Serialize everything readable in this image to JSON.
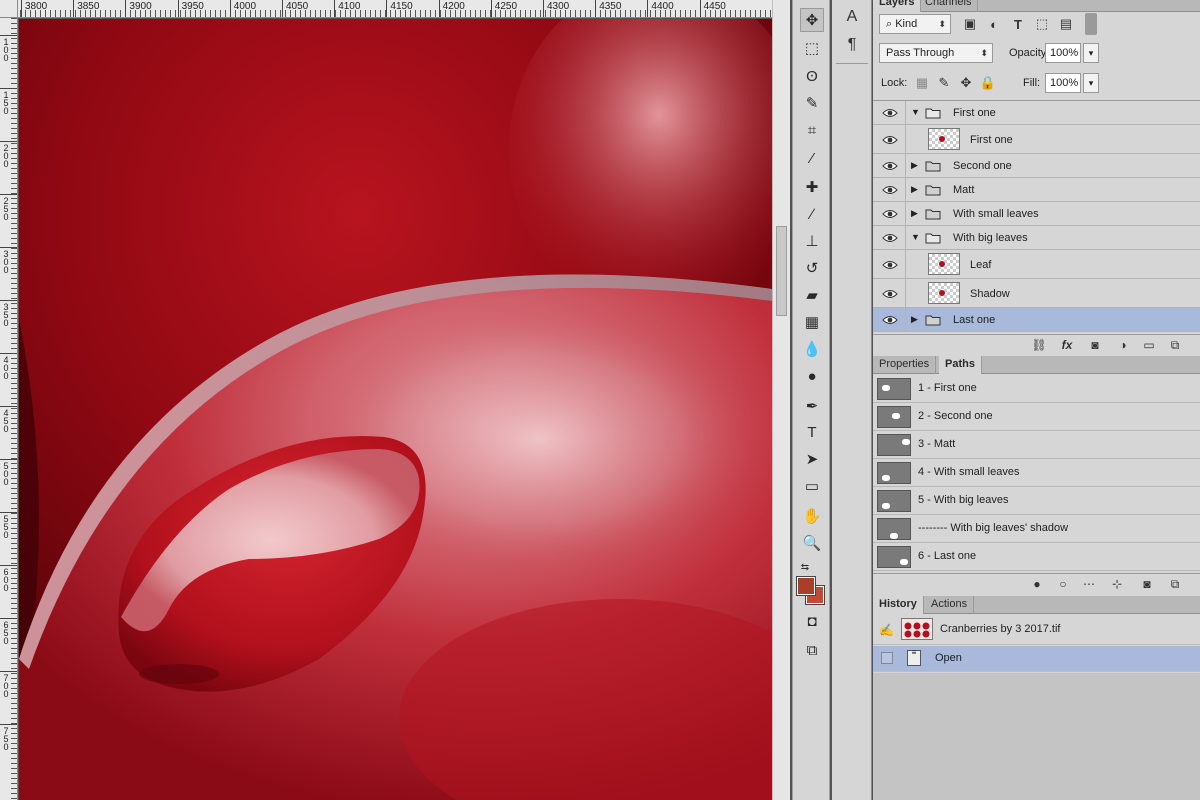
{
  "ruler": {
    "top_labels": [
      "3800",
      "3850",
      "3900",
      "3950",
      "4000",
      "4050",
      "4100",
      "4150",
      "4200",
      "4250",
      "4300",
      "4350",
      "4400",
      "4450"
    ],
    "left_labels": [
      "100",
      "150",
      "200",
      "250",
      "300",
      "350",
      "400",
      "450",
      "500",
      "550",
      "600",
      "650",
      "700",
      "750"
    ]
  },
  "tools": [
    {
      "name": "move-tool-icon",
      "glyph": "✥"
    },
    {
      "name": "marquee-tool-icon",
      "glyph": "⬚"
    },
    {
      "name": "lasso-tool-icon",
      "glyph": "ʘ"
    },
    {
      "name": "quick-select-tool-icon",
      "glyph": "✎"
    },
    {
      "name": "crop-tool-icon",
      "glyph": "⌗"
    },
    {
      "name": "eyedropper-tool-icon",
      "glyph": "⁄"
    },
    {
      "name": "healing-brush-tool-icon",
      "glyph": "✚"
    },
    {
      "name": "brush-tool-icon",
      "glyph": "∕"
    },
    {
      "name": "clone-stamp-tool-icon",
      "glyph": "⊥"
    },
    {
      "name": "history-brush-tool-icon",
      "glyph": "↺"
    },
    {
      "name": "eraser-tool-icon",
      "glyph": "▰"
    },
    {
      "name": "gradient-tool-icon",
      "glyph": "▦"
    },
    {
      "name": "blur-tool-icon",
      "glyph": "💧"
    },
    {
      "name": "dodge-tool-icon",
      "glyph": "●"
    },
    {
      "name": "pen-tool-icon",
      "glyph": "✒"
    },
    {
      "name": "type-tool-icon",
      "glyph": "T"
    },
    {
      "name": "path-selection-tool-icon",
      "glyph": "➤"
    },
    {
      "name": "rectangle-tool-icon",
      "glyph": "▭"
    },
    {
      "name": "hand-tool-icon",
      "glyph": "✋"
    },
    {
      "name": "zoom-tool-icon",
      "glyph": "🔍"
    }
  ],
  "colors": {
    "foreground": "#a84028",
    "background": "#c24a36",
    "selection": "#a9b9dc"
  },
  "layers_panel": {
    "tabs": [
      "Layers",
      "Channels"
    ],
    "filter_kind": "Kind",
    "blend_mode": "Pass Through",
    "opacity_label": "Opacity:",
    "opacity_value": "100%",
    "lock_label": "Lock:",
    "fill_label": "Fill:",
    "fill_value": "100%",
    "layers": [
      {
        "name": "First one",
        "type": "group",
        "expanded": true,
        "indent": 0
      },
      {
        "name": "First one",
        "type": "layer",
        "indent": 1
      },
      {
        "name": "Second one",
        "type": "group",
        "expanded": false,
        "indent": 0
      },
      {
        "name": "Matt",
        "type": "group",
        "expanded": false,
        "indent": 0
      },
      {
        "name": "With small leaves",
        "type": "group",
        "expanded": false,
        "indent": 0
      },
      {
        "name": "With big leaves",
        "type": "group",
        "expanded": true,
        "indent": 0
      },
      {
        "name": "Leaf",
        "type": "layer",
        "indent": 1
      },
      {
        "name": "Shadow",
        "type": "layer",
        "indent": 1
      },
      {
        "name": "Last one",
        "type": "group",
        "expanded": false,
        "indent": 0,
        "selected": true
      }
    ]
  },
  "paths_panel": {
    "tabs": [
      "Properties",
      "Paths"
    ],
    "paths": [
      "1 - First one",
      "2 - Second one",
      "3 - Matt",
      "4 - With small leaves",
      "5 - With big leaves",
      "-------- With big leaves' shadow",
      "6 - Last one"
    ]
  },
  "history_panel": {
    "tabs": [
      "History",
      "Actions"
    ],
    "snapshot": "Cranberries by 3 2017.tif",
    "items": [
      "Open"
    ]
  },
  "mini_panel": {
    "character_glyph": "A",
    "paragraph_glyph": "¶"
  }
}
